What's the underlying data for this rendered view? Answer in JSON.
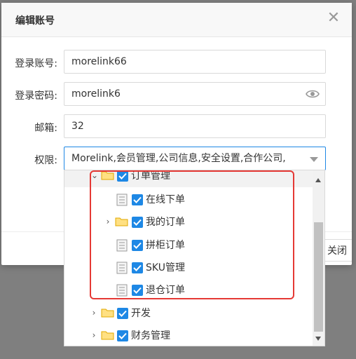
{
  "dialog": {
    "title": "编辑账号",
    "close_glyph": "✕",
    "footer_button_label": "关闭"
  },
  "form": {
    "account_label": "登录账号:",
    "account_value": "morelink66",
    "password_label": "登录密码:",
    "password_value": "morelink6",
    "email_label": "邮箱:",
    "email_value": "32",
    "permission_label": "权限:",
    "permission_value": "Morelink,会员管理,公司信息,安全设置,合作公司,"
  },
  "tree": {
    "items": [
      {
        "label": "订单管理",
        "type": "folder",
        "expanded": true,
        "checked": true
      },
      {
        "label": "在线下单",
        "type": "leaf",
        "checked": true
      },
      {
        "label": "我的订单",
        "type": "folder",
        "expanded": false,
        "checked": true
      },
      {
        "label": "拼柜订单",
        "type": "leaf",
        "checked": true
      },
      {
        "label": "SKU管理",
        "type": "leaf",
        "checked": true
      },
      {
        "label": "退仓订单",
        "type": "leaf",
        "checked": true
      },
      {
        "label": "开发",
        "type": "folder",
        "expanded": false,
        "checked": true
      },
      {
        "label": "财务管理",
        "type": "folder",
        "expanded": false,
        "checked": true
      }
    ]
  },
  "colors": {
    "accent": "#1e88e5",
    "highlight_frame": "#e53935"
  }
}
